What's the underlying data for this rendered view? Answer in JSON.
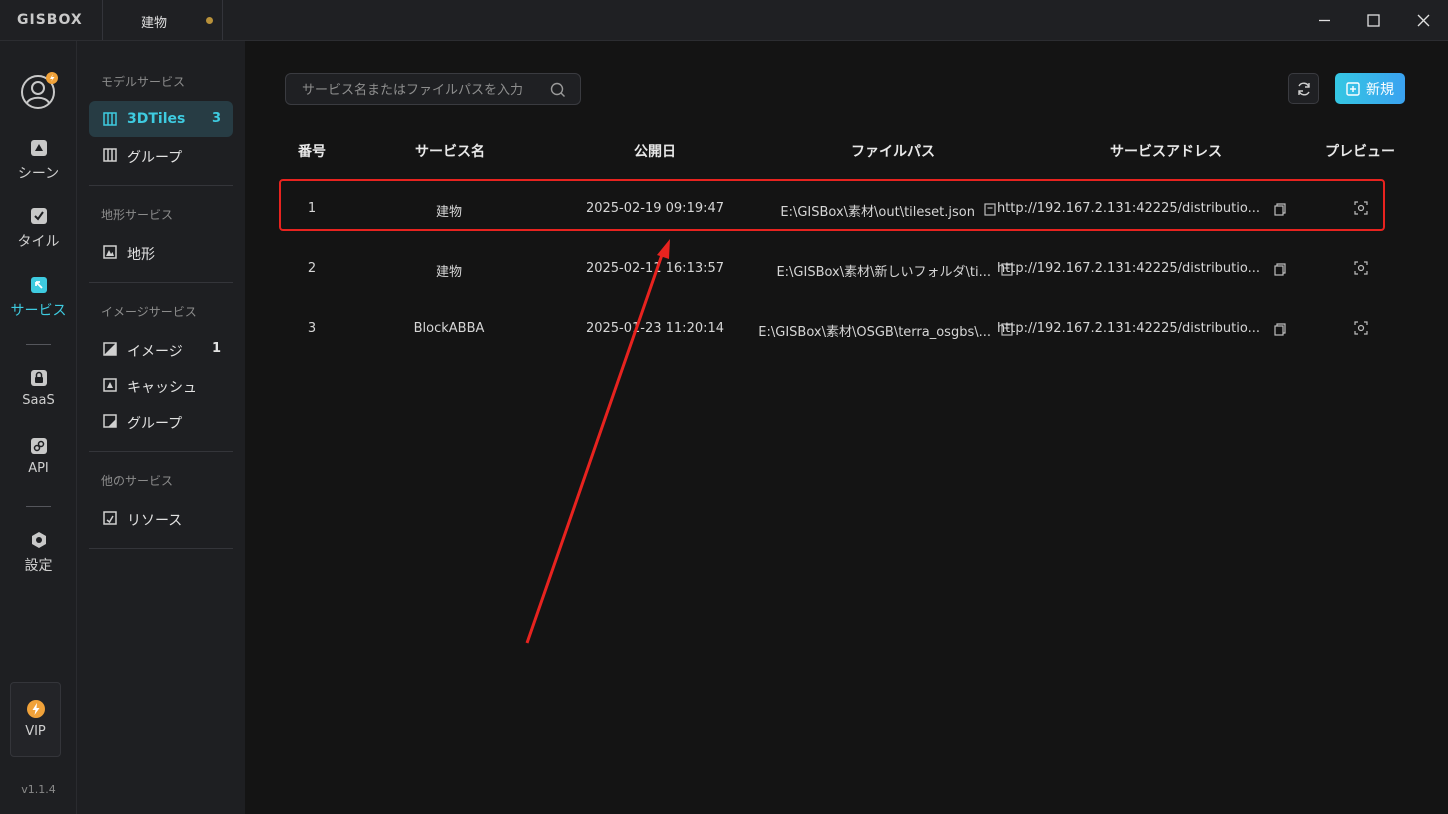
{
  "app": {
    "logo": "GISBOX",
    "tab_title": "建物"
  },
  "rail": {
    "items": [
      {
        "label": "シーン",
        "icon": "scene-icon"
      },
      {
        "label": "タイル",
        "icon": "tile-icon"
      },
      {
        "label": "サービス",
        "icon": "service-icon"
      },
      {
        "label": "SaaS",
        "icon": "saas-icon"
      },
      {
        "label": "API",
        "icon": "api-icon"
      },
      {
        "label": "設定",
        "icon": "settings-icon"
      }
    ],
    "vip_label": "VIP",
    "version": "v1.1.4"
  },
  "sidebar": {
    "model_title": "モデルサービス",
    "model_items": [
      {
        "label": "3DTiles",
        "count": "3"
      },
      {
        "label": "グループ",
        "count": ""
      }
    ],
    "terrain_title": "地形サービス",
    "terrain_items": [
      {
        "label": "地形",
        "count": ""
      }
    ],
    "image_title": "イメージサービス",
    "image_items": [
      {
        "label": "イメージ",
        "count": "1"
      },
      {
        "label": "キャッシュ",
        "count": ""
      },
      {
        "label": "グループ",
        "count": ""
      }
    ],
    "other_title": "他のサービス",
    "other_items": [
      {
        "label": "リソース",
        "count": ""
      }
    ]
  },
  "toolbar": {
    "search_placeholder": "サービス名またはファイルパスを入力",
    "new_label": "新規"
  },
  "table": {
    "headers": [
      "番号",
      "サービス名",
      "公開日",
      "ファイルパス",
      "サービスアドレス",
      "プレビュー"
    ],
    "rows": [
      {
        "no": "1",
        "name": "建物",
        "date": "2025-02-19 09:19:47",
        "path": "E:\\GISBox\\素材\\out\\tileset.json",
        "address": "http://192.167.2.131:42225/distributio..."
      },
      {
        "no": "2",
        "name": "建物",
        "date": "2025-02-11 16:13:57",
        "path": "E:\\GISBox\\素材\\新しいフォルダ\\ti...",
        "address": "http://192.167.2.131:42225/distributio..."
      },
      {
        "no": "3",
        "name": "BlockABBA",
        "date": "2025-01-23 11:20:14",
        "path": "E:\\GISBox\\素材\\OSGB\\terra_osgbs\\...",
        "address": "http://192.167.2.131:42225/distributio..."
      }
    ]
  },
  "colors": {
    "accent": "#3ecbe0",
    "highlight": "#e8231f",
    "vip": "#f0a23a"
  }
}
